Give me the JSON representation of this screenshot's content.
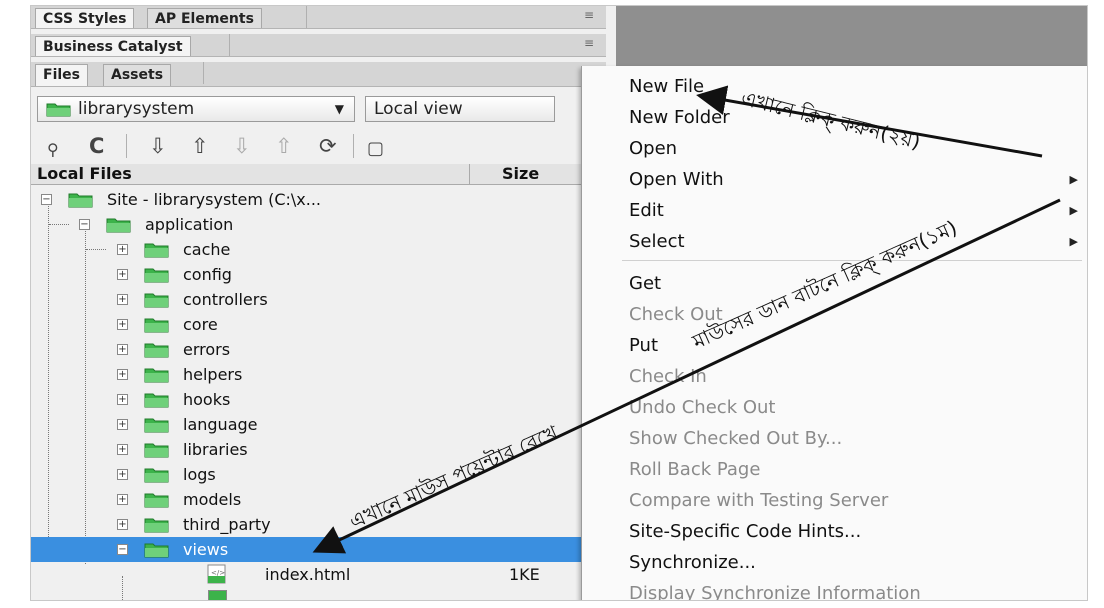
{
  "panels": {
    "row1": [
      "CSS Styles",
      "AP Elements"
    ],
    "row2": [
      "Business Catalyst"
    ],
    "row3": [
      "Files",
      "Assets"
    ],
    "menu_icon": "≡"
  },
  "site_dropdown": {
    "value": "librarysystem"
  },
  "view_dropdown": {
    "value": "Local view"
  },
  "toolbar_icons": [
    "connect-icon",
    "refresh-icon",
    "get-icon",
    "put-icon",
    "check-out-icon",
    "check-in-icon",
    "sync-icon",
    "expand-icon"
  ],
  "columns": {
    "local_files": "Local Files",
    "size": "Size"
  },
  "tree": {
    "root": "Site - librarysystem (C:\\x...",
    "application": "application",
    "folders": [
      "cache",
      "config",
      "controllers",
      "core",
      "errors",
      "helpers",
      "hooks",
      "language",
      "libraries",
      "logs",
      "models",
      "third_party"
    ],
    "views": "views",
    "file": {
      "name": "index.html",
      "size": "1KE"
    }
  },
  "context_menu": {
    "items": [
      {
        "label": "New File",
        "disabled": false,
        "submenu": false
      },
      {
        "label": "New Folder",
        "disabled": false,
        "submenu": false
      },
      {
        "label": "Open",
        "disabled": false,
        "submenu": false
      },
      {
        "label": "Open With",
        "disabled": false,
        "submenu": true
      },
      {
        "label": "Edit",
        "disabled": false,
        "submenu": true
      },
      {
        "label": "Select",
        "disabled": false,
        "submenu": true
      },
      {
        "label": "Get",
        "disabled": false,
        "submenu": false
      },
      {
        "label": "Check Out",
        "disabled": true,
        "submenu": false
      },
      {
        "label": "Put",
        "disabled": false,
        "submenu": false
      },
      {
        "label": "Check In",
        "disabled": true,
        "submenu": false
      },
      {
        "label": "Undo Check Out",
        "disabled": true,
        "submenu": false
      },
      {
        "label": "Show Checked Out By...",
        "disabled": true,
        "submenu": false
      },
      {
        "label": "Roll Back Page",
        "disabled": true,
        "submenu": false
      },
      {
        "label": "Compare with Testing Server",
        "disabled": true,
        "submenu": false
      },
      {
        "label": "Site-Specific Code Hints...",
        "disabled": false,
        "submenu": false
      },
      {
        "label": "Synchronize...",
        "disabled": false,
        "submenu": false
      },
      {
        "label": "Display Synchronize Information",
        "disabled": true,
        "submenu": false
      }
    ]
  },
  "annotations": {
    "second": "এখানে ক্লিক্ করুন(২য়)",
    "first_right": "মাউসের ডান বাটনে ক্লিক্ করুন(১ম)",
    "first_left": "এখানে মাউস পয়েন্টার রেখে"
  },
  "colors": {
    "selected": "#3a8fe0",
    "folder": "#3cb34a",
    "panel_bg": "#f0f0f0",
    "background": "#8f8f8f"
  }
}
